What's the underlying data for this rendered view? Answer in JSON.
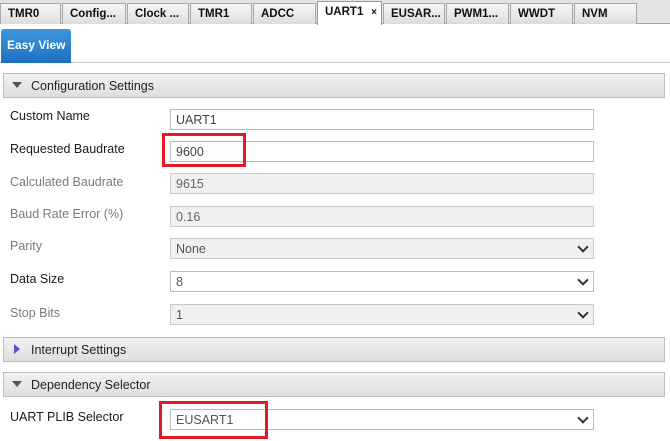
{
  "tabs": [
    {
      "label": "TMR0",
      "active": false
    },
    {
      "label": "Config...",
      "active": false
    },
    {
      "label": "Clock ...",
      "active": false
    },
    {
      "label": "TMR1",
      "active": false
    },
    {
      "label": "ADCC",
      "active": false
    },
    {
      "label": "UART1",
      "active": true,
      "close": "×"
    },
    {
      "label": "EUSAR...",
      "active": false
    },
    {
      "label": "PWM1...",
      "active": false
    },
    {
      "label": "WWDT",
      "active": false
    },
    {
      "label": "NVM",
      "active": false
    }
  ],
  "view": {
    "easy_view_label": "Easy View"
  },
  "sections": {
    "configuration": {
      "label": "Configuration Settings",
      "expanded": true
    },
    "interrupt": {
      "label": "Interrupt Settings",
      "expanded": false
    },
    "dependency": {
      "label": "Dependency Selector",
      "expanded": true
    }
  },
  "config": {
    "custom_name": {
      "label": "Custom Name",
      "value": "UART1"
    },
    "requested_baudrate": {
      "label": "Requested Baudrate",
      "value": "9600"
    },
    "calculated_baudrate": {
      "label": "Calculated Baudrate",
      "value": "9615"
    },
    "baud_rate_error": {
      "label": "Baud Rate Error (%)",
      "value": "0.16"
    },
    "parity": {
      "label": "Parity",
      "value": "None"
    },
    "data_size": {
      "label": "Data Size",
      "value": "8"
    },
    "stop_bits": {
      "label": "Stop Bits",
      "value": "1"
    }
  },
  "dependency": {
    "uart_plib_selector": {
      "label": "UART PLIB Selector",
      "value": "EUSART1"
    }
  },
  "colors": {
    "highlight": "#e01b24",
    "accent": "#1e6fc2"
  }
}
